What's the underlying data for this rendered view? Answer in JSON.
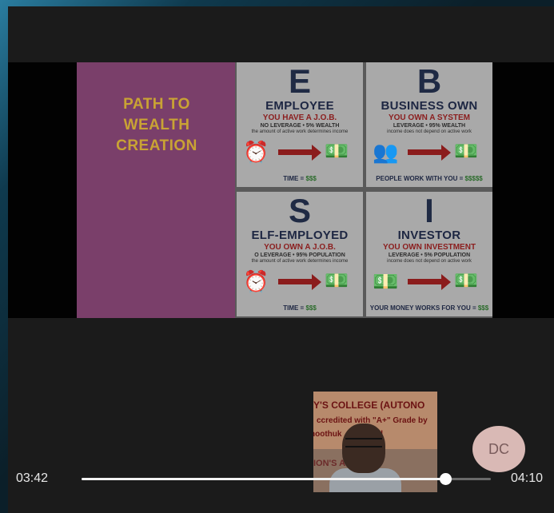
{
  "player": {
    "current_time": "03:42",
    "total_time": "04:10",
    "progress": 0.888,
    "avatar_initials": "DC"
  },
  "slide": {
    "title_lines": [
      "PATH TO",
      "WEALTH",
      "CREATION"
    ],
    "quadrants": [
      {
        "letter": "E",
        "name": "EMPLOYEE",
        "subtitle": "YOU HAVE A J.O.B.",
        "line1": "NO LEVERAGE • 5% WEALTH",
        "line2": "the amount of active work determines income",
        "icon_left": "alarm-clock",
        "icon_right": "cash-stack",
        "footer_label": "TIME = ",
        "footer_money": "$$$"
      },
      {
        "letter": "B",
        "name": "BUSINESS OWN",
        "subtitle": "YOU OWN A SYSTEM",
        "line1": "LEVERAGE • 95% WEALTH",
        "line2": "income does not depend on active work",
        "icon_left": "people-group",
        "icon_right": "cash-stack",
        "footer_label": "PEOPLE WORK WITH YOU = ",
        "footer_money": "$$$$$"
      },
      {
        "letter": "S",
        "name": "ELF-EMPLOYED",
        "subtitle": "YOU OWN A J.O.B.",
        "line1": "O LEVERAGE • 95% POPULATION",
        "line2": "the amount of active work determines income",
        "icon_left": "alarm-clock",
        "icon_right": "cash-stack",
        "footer_label": "TIME = ",
        "footer_money": "$$$"
      },
      {
        "letter": "I",
        "name": "INVESTOR",
        "subtitle": "YOU OWN INVESTMENT",
        "line1": "LEVERAGE • 5% POPULATION",
        "line2": "income does not depend on active work",
        "icon_left": "cash-stack",
        "icon_right": "cash-stack",
        "footer_label": "YOUR MONEY WORKS FOR YOU = ",
        "footer_money": "$$$"
      }
    ]
  },
  "webcam": {
    "banner_lines": [
      "Y'S COLLEGE (AUTONO",
      "ccredited with \"A+\" Grade by",
      "hoothuk      , Tamilnad",
      "ION'S      ATION"
    ]
  },
  "colors": {
    "slide_left_bg": "#7a3f6a",
    "slide_title": "#c9a334",
    "arrow": "#8b1c1c",
    "money_green": "#2a6b2a",
    "avatar_bg": "#d9b9b5"
  }
}
